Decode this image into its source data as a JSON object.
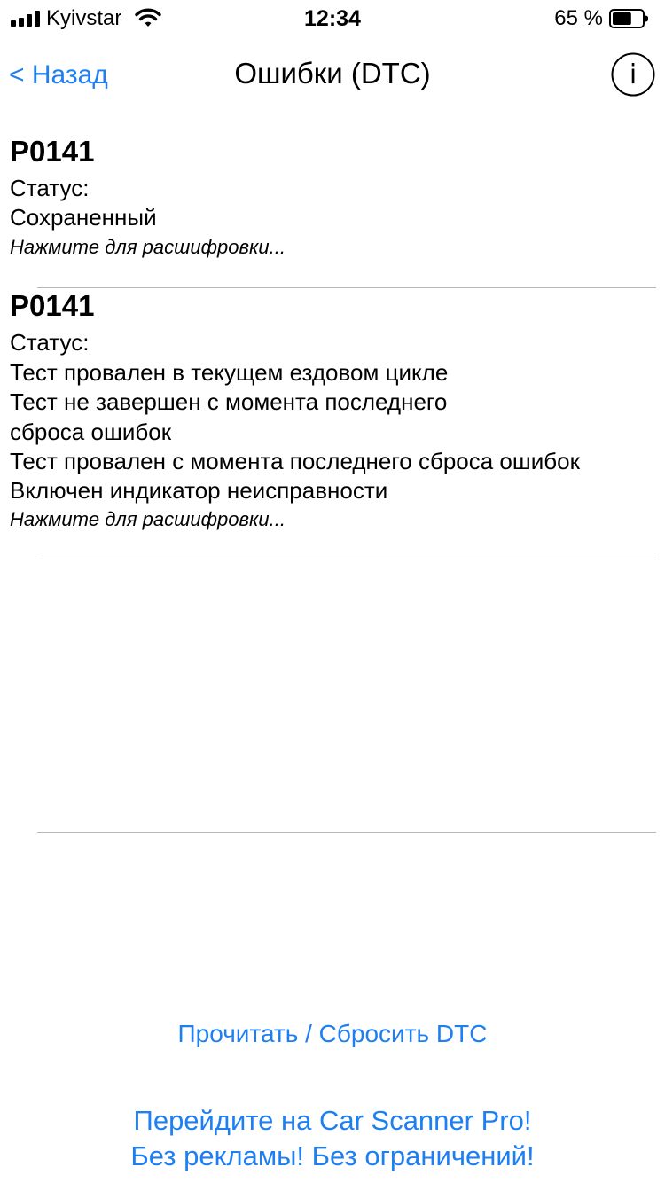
{
  "status_bar": {
    "carrier": "Kyivstar",
    "time": "12:34",
    "battery_percent": "65 %",
    "battery_level": 0.65,
    "signal_icon": "signal-bars-icon",
    "wifi_icon": "wifi-icon",
    "battery_icon": "battery-icon"
  },
  "nav": {
    "back_label": "< Назад",
    "title": "Ошибки (DTC)",
    "info_icon": "info-icon",
    "info_label": "i"
  },
  "dtc_items": [
    {
      "code": "P0141",
      "status_label": "Статус:",
      "status_lines": [
        "Сохраненный"
      ],
      "hint": "Нажмите для расшифровки..."
    },
    {
      "code": "P0141",
      "status_label": "Статус:",
      "status_lines": [
        "Тест провален в текущем ездовом цикле",
        "Тест не завершен с момента последнего",
        "сброса ошибок",
        "Тест провален с момента последнего сброса ошибок",
        "Включен индикатор неисправности"
      ],
      "hint": "Нажмите для расшифровки..."
    }
  ],
  "actions": {
    "read_reset_label": "Прочитать / Сбросить DTC",
    "promo_line1": "Перейдите на Car Scanner Pro!",
    "promo_line2": "Без рекламы! Без ограничений!"
  },
  "colors": {
    "accent": "#1d7ff2",
    "separator": "#b8b8bc",
    "text": "#000000",
    "background": "#ffffff"
  }
}
